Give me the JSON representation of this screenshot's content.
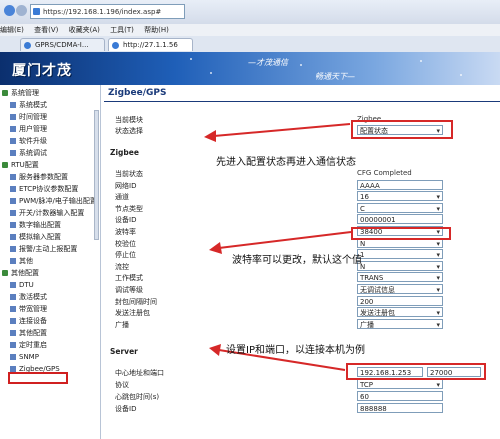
{
  "browser": {
    "url": "https://192.168.1.196/index.asp#",
    "menu": [
      "编辑(E)",
      "查看(V)",
      "收藏夹(A)",
      "工具(T)",
      "帮助(H)"
    ],
    "tabs": [
      "GPRS/CDMA-I...",
      "http://27.1.1.56"
    ]
  },
  "site": {
    "logo": "厦门才茂",
    "slogan1": "—才茂通信",
    "slogan2": "畅通天下—"
  },
  "sidebar": {
    "items": [
      {
        "label": "系统管理",
        "type": "cat"
      },
      {
        "label": "系统模式",
        "type": "item"
      },
      {
        "label": "时间管理",
        "type": "item"
      },
      {
        "label": "用户管理",
        "type": "item"
      },
      {
        "label": "软件升级",
        "type": "item"
      },
      {
        "label": "系统调试",
        "type": "item"
      },
      {
        "label": "RTU配置",
        "type": "cat"
      },
      {
        "label": "服务器参数配置",
        "type": "item"
      },
      {
        "label": "ETCP协议参数配置",
        "type": "item"
      },
      {
        "label": "PWM/脉冲/电子输出配置",
        "type": "item"
      },
      {
        "label": "开关/计数器输入配置",
        "type": "item"
      },
      {
        "label": "数字输出配置",
        "type": "item"
      },
      {
        "label": "模拟输入配置",
        "type": "item"
      },
      {
        "label": "报警/主动上报配置",
        "type": "item"
      },
      {
        "label": "其他",
        "type": "item"
      },
      {
        "label": "其他配置",
        "type": "cat"
      },
      {
        "label": "DTU",
        "type": "item"
      },
      {
        "label": "激活模式",
        "type": "item"
      },
      {
        "label": "带宽管理",
        "type": "item"
      },
      {
        "label": "连接设备",
        "type": "item"
      },
      {
        "label": "其他配置",
        "type": "item"
      },
      {
        "label": "定时重启",
        "type": "item"
      },
      {
        "label": "SNMP",
        "type": "item"
      },
      {
        "label": "Zigbee/GPS",
        "type": "item"
      }
    ]
  },
  "main": {
    "title": "Zigbee/GPS",
    "current_module_label": "当前模块",
    "current_module_value": "Zigbee",
    "state_label": "状态选择",
    "state_value": "配置状态",
    "section_zigbee": "Zigbee",
    "zigbee_fields": [
      {
        "label": "当前状态",
        "value": "CFG Completed",
        "kind": "plain"
      },
      {
        "label": "网络ID",
        "value": "AAAA",
        "kind": "input"
      },
      {
        "label": "通道",
        "value": "16",
        "kind": "select"
      },
      {
        "label": "节点类型",
        "value": "C",
        "kind": "select"
      },
      {
        "label": "设备ID",
        "value": "00000001",
        "kind": "input"
      },
      {
        "label": "波特率",
        "value": "38400",
        "kind": "select"
      },
      {
        "label": "校验位",
        "value": "N",
        "kind": "select"
      },
      {
        "label": "停止位",
        "value": "1",
        "kind": "select"
      },
      {
        "label": "流控",
        "value": "N",
        "kind": "select"
      },
      {
        "label": "工作模式",
        "value": "TRANS",
        "kind": "select"
      },
      {
        "label": "调试等级",
        "value": "无调试信息",
        "kind": "select"
      },
      {
        "label": "封包间隔时间",
        "value": "200",
        "kind": "input"
      },
      {
        "label": "发送注册包",
        "value": "发送注册包",
        "kind": "select"
      },
      {
        "label": "广播",
        "value": "广播",
        "kind": "select"
      }
    ],
    "section_server": "Server",
    "server_fields": [
      {
        "label": "中心地址和端口",
        "value": "192.168.1.253",
        "port": "27000",
        "kind": "addr"
      },
      {
        "label": "协议",
        "value": "TCP",
        "kind": "select"
      },
      {
        "label": "心跳包时间(s)",
        "value": "60",
        "kind": "input"
      },
      {
        "label": "设备ID",
        "value": "888888",
        "kind": "input"
      }
    ]
  },
  "annotations": {
    "a1": "先进入配置状态再进入通信状态",
    "a2": "波特率可以更改，默认这个值",
    "a3": "设置IP和端口，以连接本机为例"
  },
  "colors": {
    "annotation_red": "#d62828",
    "banner_dark": "#0b2f6e",
    "title_blue": "#1a3a7a"
  }
}
